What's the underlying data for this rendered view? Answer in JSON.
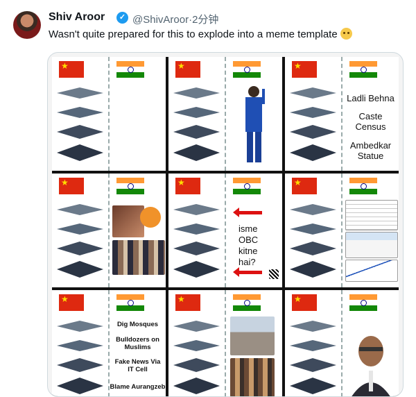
{
  "tweet": {
    "author_name": "Shiv Aroor",
    "handle": "@ShivAroor",
    "time": "·2分钟",
    "text": "Wasn't quite prepared for this to explode into a meme template",
    "emoji_icon": "grimacing-face-emoji"
  },
  "colors": {
    "accent": "#1d9bf0",
    "text": "#0f1419",
    "muted": "#536471"
  },
  "panels": [
    {
      "id": "p1",
      "right_text": []
    },
    {
      "id": "p2",
      "right_text": []
    },
    {
      "id": "p3",
      "right_text": [
        "Ladli Behna",
        "Caste Census",
        "Ambedkar Statue"
      ]
    },
    {
      "id": "p4",
      "right_text": []
    },
    {
      "id": "p5",
      "right_text": [
        "isme",
        "OBC",
        "kitne",
        "hai?"
      ]
    },
    {
      "id": "p6",
      "right_text": []
    },
    {
      "id": "p7",
      "right_text": [
        "Dig Mosques",
        "Bulldozers on Muslims",
        "Fake News Via IT Cell",
        "Blame Aurangzeb"
      ]
    },
    {
      "id": "p8",
      "right_text": []
    },
    {
      "id": "p9",
      "right_text": []
    }
  ]
}
